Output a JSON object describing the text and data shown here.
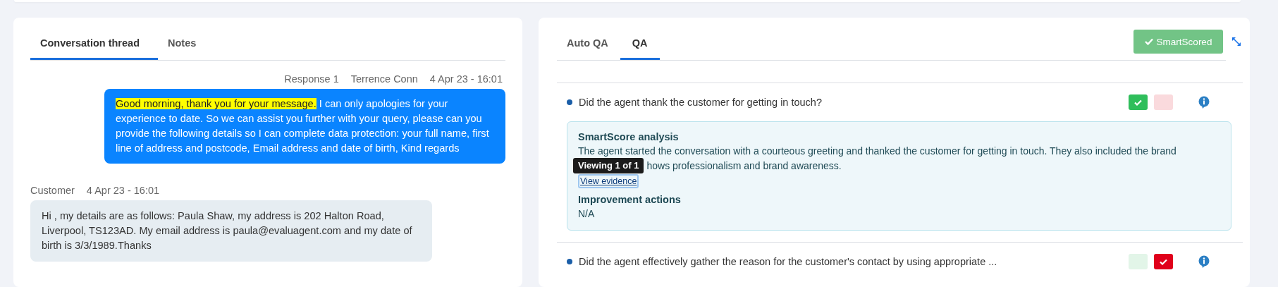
{
  "conversation_panel": {
    "tabs": [
      {
        "label": "Conversation thread",
        "selected": true
      },
      {
        "label": "Notes",
        "selected": false
      }
    ],
    "messages": [
      {
        "kind": "agent",
        "meta": [
          "Response 1",
          "Terrence Conn",
          "4 Apr 23 - 16:01"
        ],
        "segments": [
          {
            "text": "Good morning, thank you for your message.",
            "highlighted": true
          },
          {
            "text": " I can only apologies for your experience to date. So we can assist you further with your query, please can you provide the following details so I can complete data protection: your full name, first line of address and postcode, Email address and date of birth, Kind regards",
            "highlighted": false
          }
        ]
      },
      {
        "kind": "customer",
        "meta": [
          "Customer",
          "4 Apr 23 - 16:01"
        ],
        "segments": [
          {
            "text": "Hi , my details are as follows: Paula Shaw, my address is 202 Halton Road, Liverpool, TS123AD. My email address is paula@evaluagent.com and my date of birth is 3/3/1989.Thanks",
            "highlighted": false
          }
        ]
      }
    ]
  },
  "qa_panel": {
    "tabs": [
      {
        "label": "Auto QA",
        "selected": false
      },
      {
        "label": "QA",
        "selected": true
      }
    ],
    "status_button": "SmartScored",
    "questions": [
      {
        "text": "Did the agent thank the customer for getting in touch?",
        "answers": [
          {
            "kind": "pass",
            "selected": true
          },
          {
            "kind": "fail",
            "selected": false
          }
        ],
        "analysis": {
          "heading": "SmartScore analysis",
          "text_lines": [
            "The agent started the conversation with a courteous greeting and thanked the customer for getting in touch. They also included the brand",
            "hows professionalism and brand awareness."
          ],
          "link": "View evidence",
          "tooltip": "Viewing 1 of 1",
          "actions_heading": "Improvement actions",
          "actions_text": "N/A"
        }
      },
      {
        "text": "Did the agent effectively gather the reason for the customer's contact by using appropriate ...",
        "answers": [
          {
            "kind": "pass",
            "selected": false
          },
          {
            "kind": "fail",
            "selected": true
          }
        ]
      }
    ]
  }
}
